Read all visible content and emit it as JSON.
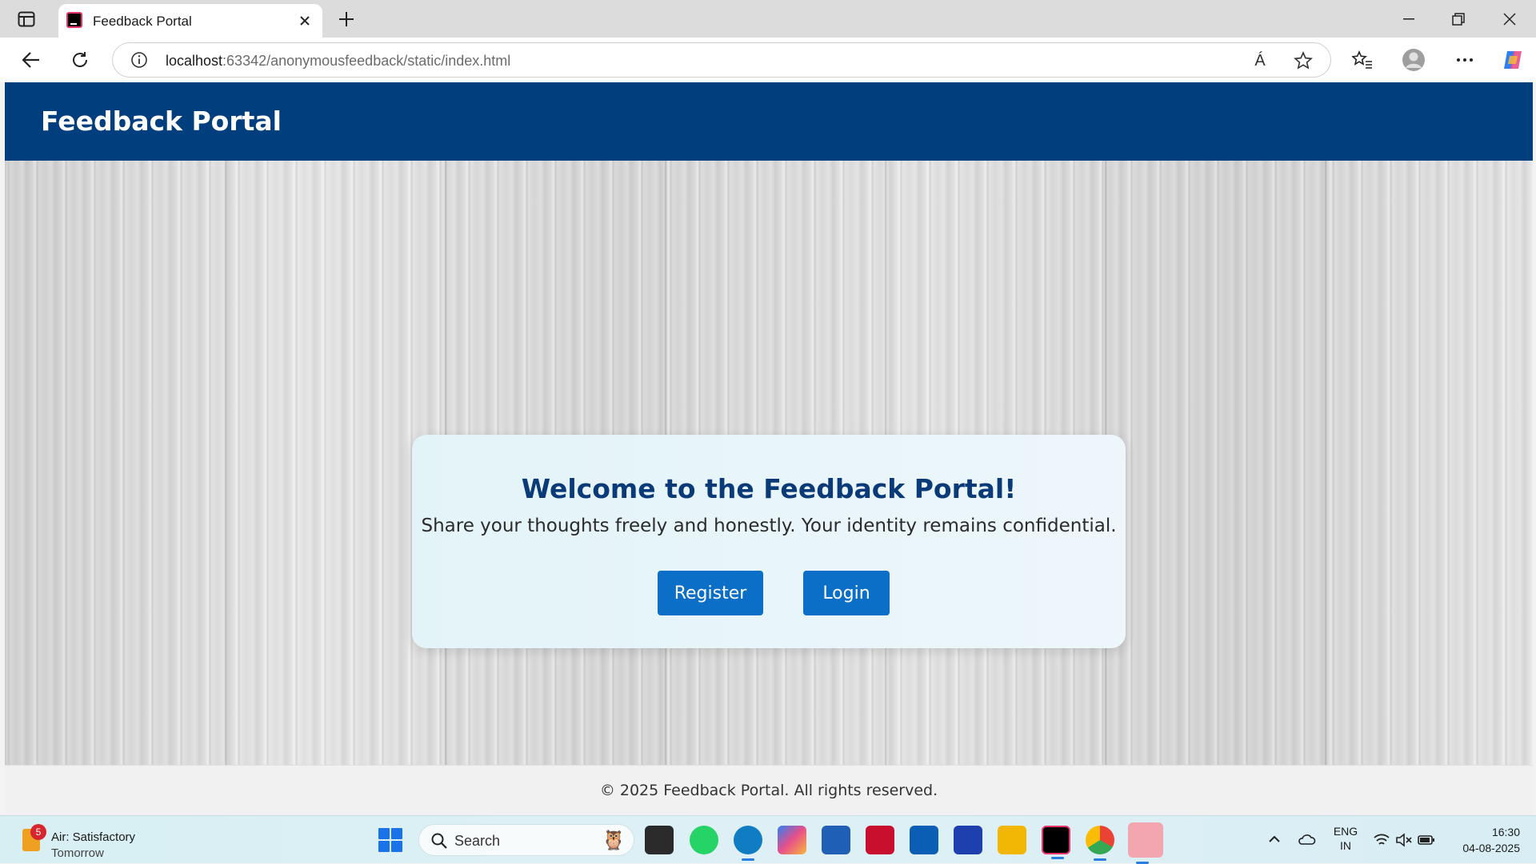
{
  "browser": {
    "tab_title": "Feedback Portal",
    "address_host": "localhost",
    "address_path": ":63342/anonymousfeedback/static/index.html",
    "read_aloud_label": "Á"
  },
  "site": {
    "header_title": "Feedback Portal",
    "welcome_title": "Welcome to the Feedback Portal!",
    "welcome_subtitle": "Share your thoughts freely and honestly. Your identity remains confidential.",
    "register_label": "Register",
    "login_label": "Login",
    "footer_text": "© 2025 Feedback Portal. All rights reserved."
  },
  "taskbar": {
    "weather_badge": "5",
    "weather_line1": "Air: Satisfactory",
    "weather_line2": "Tomorrow",
    "search_label": "Search",
    "lang_line1": "ENG",
    "lang_line2": "IN",
    "time": "16:30",
    "date": "04-08-2025"
  },
  "colors": {
    "header_bg": "#003e7e",
    "title_text": "#0a3a78",
    "button_bg": "#0b6fc7"
  },
  "icons": [
    "tab-actions-icon",
    "close-icon",
    "plus-icon",
    "minimize-icon",
    "restore-icon",
    "back-icon",
    "refresh-icon",
    "info-icon",
    "read-aloud-icon",
    "star-icon",
    "favorites-icon",
    "profile-icon",
    "more-icon",
    "copilot-icon",
    "windows-start-icon",
    "search-icon",
    "wifi-icon",
    "mute-icon",
    "battery-icon"
  ]
}
